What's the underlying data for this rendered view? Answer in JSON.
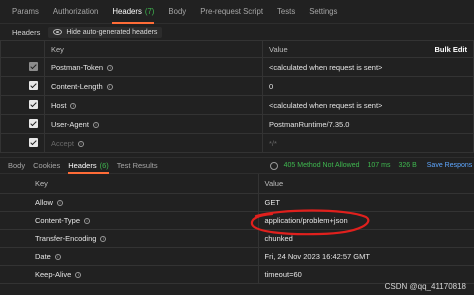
{
  "request_tabs": [
    {
      "label": "Params"
    },
    {
      "label": "Authorization"
    },
    {
      "label": "Headers",
      "count": "(7)",
      "active": true
    },
    {
      "label": "Body"
    },
    {
      "label": "Pre-request Script"
    },
    {
      "label": "Tests"
    },
    {
      "label": "Settings"
    }
  ],
  "headers_section": {
    "title": "Headers",
    "hide_button": "Hide auto-generated headers"
  },
  "request_table": {
    "key_header": "Key",
    "value_header": "Value",
    "bulk_edit": "Bulk Edit",
    "rows": [
      {
        "key": "Postman-Token",
        "value": "<calculated when request is sent>",
        "checked": true,
        "disabled": true
      },
      {
        "key": "Content-Length",
        "value": "0",
        "checked": true,
        "disabled": false
      },
      {
        "key": "Host",
        "value": "<calculated when request is sent>",
        "checked": true,
        "disabled": false
      },
      {
        "key": "User-Agent",
        "value": "PostmanRuntime/7.35.0",
        "checked": true,
        "disabled": false
      },
      {
        "key": "Accept",
        "value": "*/*",
        "checked": true,
        "disabled": false
      }
    ]
  },
  "response_tabs": [
    {
      "label": "Body"
    },
    {
      "label": "Cookies"
    },
    {
      "label": "Headers",
      "count": "(6)",
      "active": true
    },
    {
      "label": "Test Results"
    }
  ],
  "response_meta": {
    "status": "405 Method Not Allowed",
    "time": "107 ms",
    "size": "326 B",
    "save_label": "Save Respons"
  },
  "response_table": {
    "key_header": "Key",
    "value_header": "Value",
    "rows": [
      {
        "key": "Allow",
        "value": "GET"
      },
      {
        "key": "Content-Type",
        "value": "application/problem+json"
      },
      {
        "key": "Transfer-Encoding",
        "value": "chunked"
      },
      {
        "key": "Date",
        "value": "Fri, 24 Nov 2023 16:42:57 GMT"
      },
      {
        "key": "Keep-Alive",
        "value": "timeout=60"
      }
    ]
  },
  "watermark": "CSDN @qq_41170818",
  "colors": {
    "accent": "#ff6c37",
    "success": "#3fb950",
    "link": "#5ea7ff",
    "annotation": "#e0201d"
  }
}
